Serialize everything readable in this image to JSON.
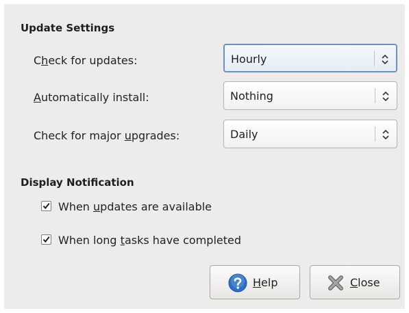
{
  "update_settings": {
    "title": "Update Settings",
    "rows": [
      {
        "label_pre": "C",
        "label_mn": "h",
        "label_post": "eck for updates:",
        "value": "Hourly"
      },
      {
        "label_pre": "",
        "label_mn": "A",
        "label_post": "utomatically install:",
        "value": "Nothing"
      },
      {
        "label_pre": "Check for major ",
        "label_mn": "u",
        "label_post": "pgrades:",
        "value": "Daily"
      }
    ]
  },
  "display_notification": {
    "title": "Display Notification",
    "options": [
      {
        "pre": "When ",
        "mn": "u",
        "post": "pdates are available",
        "checked": true
      },
      {
        "pre": "When long ",
        "mn": "t",
        "post": "asks have completed",
        "checked": true
      }
    ]
  },
  "buttons": {
    "help": {
      "mn": "H",
      "post": "elp",
      "icon": "help-icon"
    },
    "close": {
      "mn": "C",
      "post": "lose",
      "icon": "close-icon"
    }
  },
  "colors": {
    "focus_border": "#6b8fbf",
    "help_icon_blue": "#2d6fc4"
  }
}
